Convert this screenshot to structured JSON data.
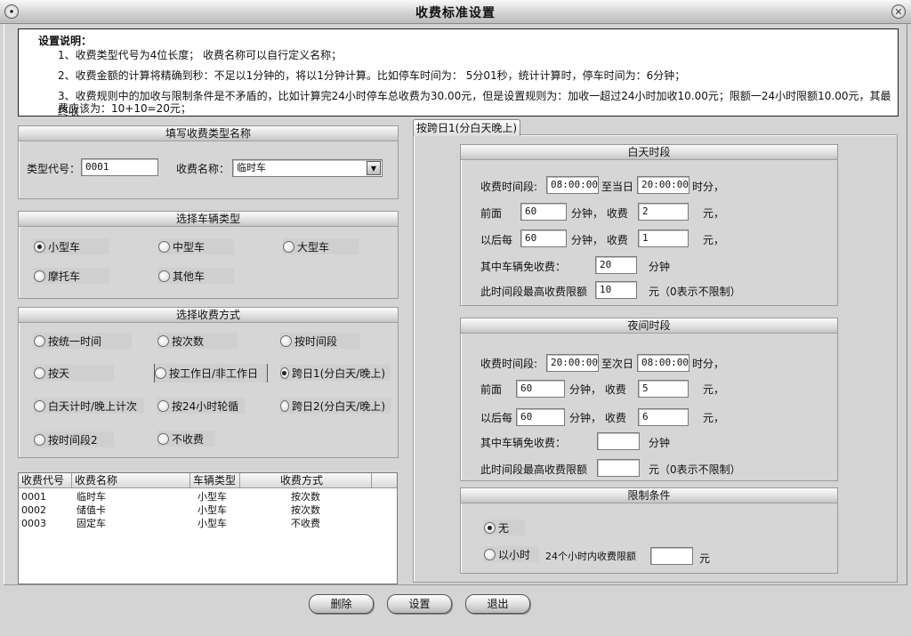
{
  "window": {
    "title": "收费标准设置",
    "menu_glyph": "•",
    "close_glyph": "✕"
  },
  "description": {
    "heading": "设置说明：",
    "lines": [
      "1、收费类型代号为4位长度；  收费名称可以自行定义名称；",
      "2、收费金额的计算将精确到秒：不足以1分钟的，将以1分钟计算。比如停车时间为： 5分01秒，统计计算时，停车时间为：6分钟；",
      "3、收费规则中的加收与限制条件是不矛盾的，比如计算完24小时停车总收费为30.00元，但是设置规则为：加收一超过24小时加收10.00元；限额一24小时限额10.00元，其最终收",
      "费应该为：10+10=20元；"
    ]
  },
  "fee_type": {
    "header": "填写收费类型名称",
    "code_label": "类型代号：",
    "code_value": "0001",
    "name_label": "收费名称：",
    "name_value": "临时车"
  },
  "vehicle_type": {
    "header": "选择车辆类型",
    "options": [
      "小型车",
      "中型车",
      "大型车",
      "摩托车",
      "其他车"
    ],
    "selected": "小型车"
  },
  "fee_method": {
    "header": "选择收费方式",
    "options": [
      "按统一时间",
      "按次数",
      "按时间段",
      "按天",
      "按工作日/非工作日",
      "跨日1(分白天/晚上)",
      "白天计时/晚上计次",
      "按24小时轮循",
      "跨日2(分白天/晚上)",
      "按时间段2",
      "不收费"
    ],
    "selected": "跨日1(分白天/晚上)"
  },
  "table": {
    "columns": [
      "收费代号",
      "收费名称",
      "车辆类型",
      "收费方式"
    ],
    "rows": [
      [
        "0001",
        "临时车",
        "小型车",
        "按次数"
      ],
      [
        "0002",
        "储值卡",
        "小型车",
        "按次数"
      ],
      [
        "0003",
        "固定车",
        "小型车",
        "不收费"
      ]
    ]
  },
  "tab": {
    "label": "按跨日1(分白天晚上)"
  },
  "day": {
    "header": "白天时段",
    "period_label": "收费时间段:",
    "start": "08:00:00",
    "to_label": "至当日",
    "end": "20:00:00",
    "hm_label": "时分，",
    "first_label": "前面",
    "first_minutes": "60",
    "minutes_fee_label": "分钟，  收费",
    "first_fee": "2",
    "yuan": "元，",
    "after_label": "以后每",
    "after_minutes": "60",
    "after_fee": "1",
    "free_label": "其中车辆免收费：",
    "free_value": "20",
    "free_unit": "分钟",
    "max_label": "此时间段最高收费限额",
    "max_value": "10",
    "max_unit": "元（0表示不限制）"
  },
  "night": {
    "header": "夜间时段",
    "period_label": "收费时间段:",
    "start": "20:00:00",
    "to_label": "至次日",
    "end": "08:00:00",
    "hm_label": "时分，",
    "first_label": "前面",
    "first_minutes": "60",
    "minutes_fee_label": "分钟，  收费",
    "first_fee": "5",
    "yuan": "元，",
    "after_label": "以后每",
    "after_minutes": "60",
    "after_fee": "6",
    "free_label": "其中车辆免收费：",
    "free_value": "",
    "free_unit": "分钟",
    "max_label": "此时间段最高收费限额",
    "max_value": "",
    "max_unit": "元（0表示不限制）"
  },
  "limit": {
    "header": "限制条件",
    "option_none": "无",
    "option_hours": "以小时",
    "hours_label": "24个小时内收费限额",
    "hours_value": "",
    "unit": "元",
    "selected": "无"
  },
  "buttons": {
    "delete": "删除",
    "set": "设置",
    "exit": "退出"
  }
}
